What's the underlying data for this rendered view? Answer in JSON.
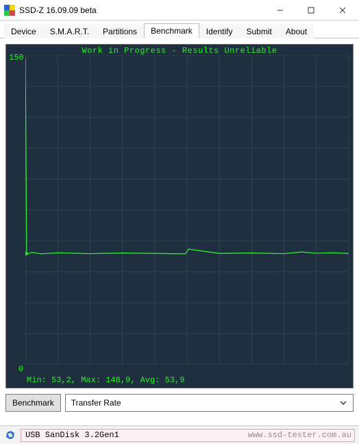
{
  "window": {
    "title": "SSD-Z 16.09.09 beta"
  },
  "tabs": [
    "Device",
    "S.M.A.R.T.",
    "Partitions",
    "Benchmark",
    "Identify",
    "Submit",
    "About"
  ],
  "active_tab_index": 3,
  "chart": {
    "top_label": "Work in Progress - Results Unreliable",
    "y_max_label": "150",
    "y_min_label": "0",
    "stats": "Min: 53,2, Max: 148,9, Avg: 53,9"
  },
  "controls": {
    "benchmark_btn": "Benchmark",
    "mode_select": "Transfer Rate"
  },
  "status": {
    "device": "USB SanDisk 3.2Gen1",
    "watermark": "www.ssd-tester.com.au"
  },
  "chart_data": {
    "type": "line",
    "title": "Work in Progress - Results Unreliable",
    "xlabel": "",
    "ylabel": "",
    "ylim": [
      0,
      150
    ],
    "stats": {
      "min": 53.2,
      "max": 148.9,
      "avg": 53.9
    },
    "x": [
      0,
      0.4,
      0.9,
      2,
      5,
      10,
      20,
      30,
      40,
      49.5,
      50.5,
      60,
      70,
      80,
      85.5,
      90,
      95,
      100
    ],
    "values": [
      148.9,
      53.2,
      53.9,
      54.4,
      53.7,
      54.2,
      53.8,
      54.1,
      53.9,
      53.7,
      56.0,
      53.9,
      54.1,
      53.8,
      54.6,
      54.0,
      54.2,
      53.9
    ]
  }
}
